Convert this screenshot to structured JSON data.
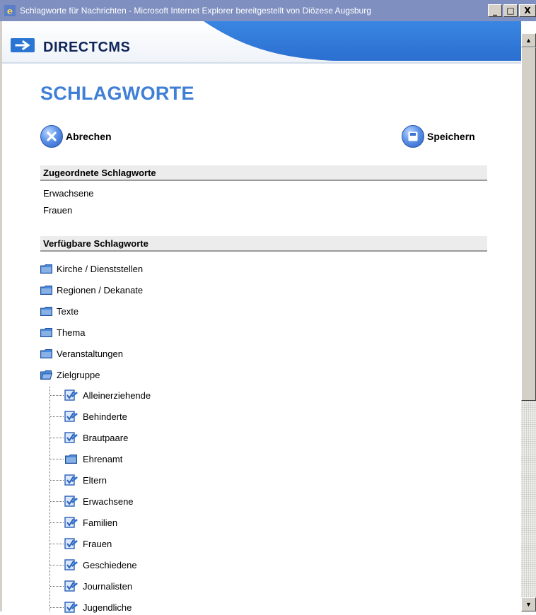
{
  "window": {
    "title": "Schlagworte für Nachrichten - Microsoft Internet Explorer bereitgestellt von Diözese Augsburg",
    "minimize_glyph": "_",
    "maximize_glyph": "□",
    "close_glyph": "X"
  },
  "header": {
    "logo": "DIRECTCMS"
  },
  "page": {
    "title": "SCHLAGWORTE"
  },
  "actions": {
    "cancel": "Abrechen",
    "save": "Speichern"
  },
  "assigned": {
    "heading": "Zugeordnete Schlagworte",
    "items": [
      "Erwachsene",
      "Frauen"
    ]
  },
  "available": {
    "heading": "Verfügbare Schlagworte",
    "folders": [
      "Kirche / Dienststellen",
      "Regionen / Dekanate",
      "Texte",
      "Thema",
      "Veranstaltungen",
      "Zielgruppe"
    ],
    "zielgruppe_children": [
      {
        "label": "Alleinerziehende",
        "type": "tag"
      },
      {
        "label": "Behinderte",
        "type": "tag"
      },
      {
        "label": "Brautpaare",
        "type": "tag"
      },
      {
        "label": "Ehrenamt",
        "type": "folder"
      },
      {
        "label": "Eltern",
        "type": "tag"
      },
      {
        "label": "Erwachsene",
        "type": "tag"
      },
      {
        "label": "Familien",
        "type": "tag"
      },
      {
        "label": "Frauen",
        "type": "tag"
      },
      {
        "label": "Geschiedene",
        "type": "tag"
      },
      {
        "label": "Journalisten",
        "type": "tag"
      },
      {
        "label": "Jugendliche",
        "type": "tag"
      }
    ]
  },
  "colors": {
    "title_blue": "#3f7fd6",
    "banner_blue": "#2f78d8",
    "titlebar": "#7f8fc0",
    "section_bg": "#ececec"
  },
  "scrollbar": {
    "up_glyph": "▲",
    "down_glyph": "▼"
  }
}
